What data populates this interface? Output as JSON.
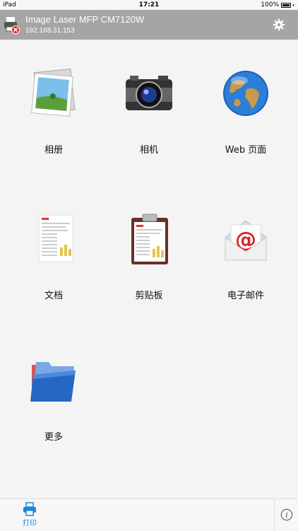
{
  "status_bar": {
    "device": "iPad",
    "time": "17:21",
    "battery": "100%"
  },
  "header": {
    "printer_name": "Image Laser MFP CM7120W",
    "ip_address": "192.168.31.153"
  },
  "tiles": [
    {
      "label": "相册",
      "icon": "photo-album-icon"
    },
    {
      "label": "相机",
      "icon": "camera-icon"
    },
    {
      "label": "Web 页面",
      "icon": "globe-icon"
    },
    {
      "label": "文档",
      "icon": "document-icon"
    },
    {
      "label": "剪贴板",
      "icon": "clipboard-icon"
    },
    {
      "label": "电子邮件",
      "icon": "email-icon"
    },
    {
      "label": "更多",
      "icon": "folder-icon"
    }
  ],
  "tabbar": {
    "print_label": "打印"
  },
  "colors": {
    "header_bg": "#a5a5a5",
    "accent": "#1e88d8",
    "background": "#f4f4f4"
  }
}
